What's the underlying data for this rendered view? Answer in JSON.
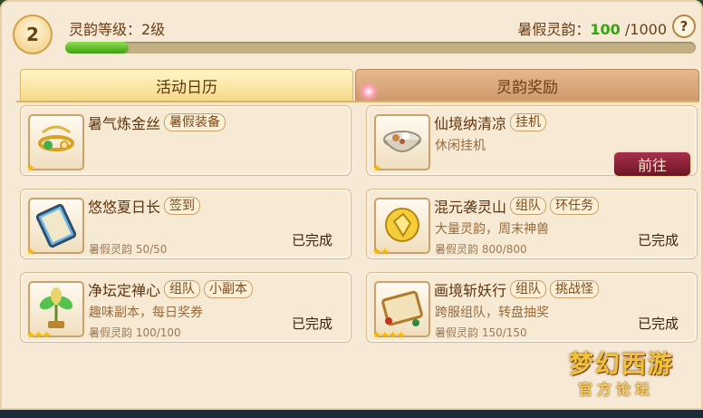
{
  "header": {
    "level_badge": "2",
    "level_text": "灵韵等级：2级",
    "points_label": "暑假灵韵：",
    "points_current": "100",
    "points_max": "/1000",
    "progress_fraction": 0.1,
    "help_label": "?"
  },
  "tabs": [
    {
      "label": "活动日历"
    },
    {
      "label": "灵韵奖励"
    }
  ],
  "cards": [
    {
      "name": "暑气炼金丝",
      "tags": [
        "暑假装备"
      ],
      "desc": "",
      "progress": "",
      "status": "",
      "stars": "★",
      "icon": "golden-ornament-icon"
    },
    {
      "name": "仙境纳清凉",
      "tags": [
        "挂机"
      ],
      "desc": "休闲挂机",
      "progress": "",
      "status": "",
      "stars": "★",
      "button": "前往",
      "icon": "dessert-bowl-icon"
    },
    {
      "name": "悠悠夏日长",
      "tags": [
        "签到"
      ],
      "desc": "",
      "progress": "暑假灵韵 50/50",
      "status": "已完成",
      "stars": "★",
      "icon": "scroll-icon"
    },
    {
      "name": "混元袭灵山",
      "tags": [
        "组队",
        "环任务"
      ],
      "desc": "大量灵韵，周末神兽",
      "progress": "暑假灵韵 800/800",
      "status": "已完成",
      "stars": "★★",
      "icon": "golden-treasure-icon"
    },
    {
      "name": "净坛定禅心",
      "tags": [
        "组队",
        "小副本"
      ],
      "desc": "趣味副本，每日奖券",
      "progress": "暑假灵韵 100/100",
      "status": "已完成",
      "stars": "★★★",
      "icon": "jade-plant-icon"
    },
    {
      "name": "画境斩妖行",
      "tags": [
        "组队",
        "挑战怪"
      ],
      "desc": "跨服组队，转盘抽奖",
      "progress": "暑假灵韵 150/150",
      "status": "已完成",
      "stars": "★★★★",
      "icon": "painting-scroll-icon"
    }
  ],
  "logo": {
    "main": "梦幻西游",
    "sub": "官方论坛"
  },
  "colors": {
    "accent_green": "#36a313",
    "button": "#8a1f37",
    "panel": "#f6ead6"
  }
}
